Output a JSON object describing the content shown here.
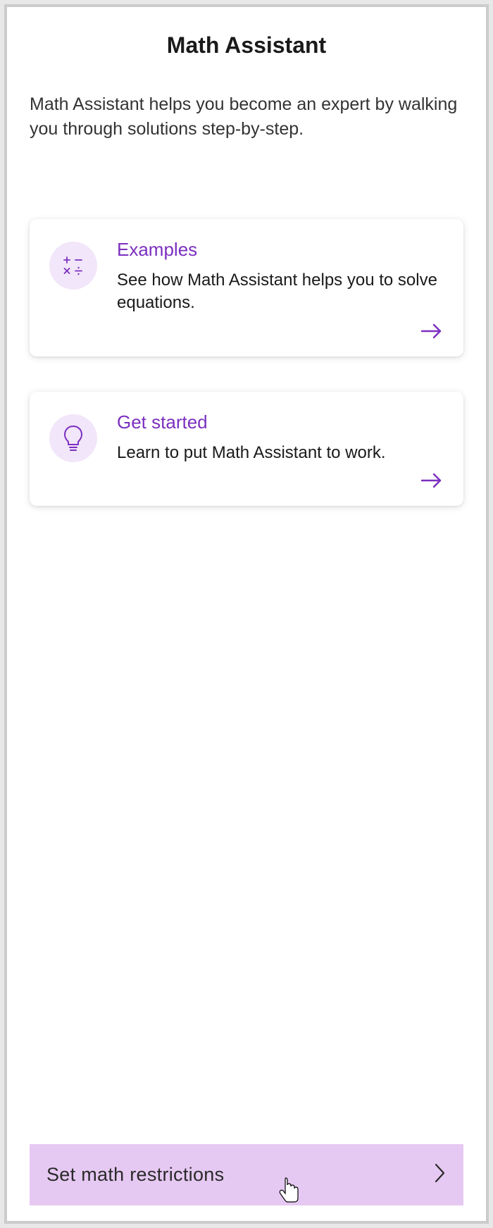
{
  "header": {
    "title": "Math Assistant"
  },
  "intro": {
    "text": "Math Assistant helps you become an expert by walking you through solutions step-by-step."
  },
  "cards": {
    "examples": {
      "title": "Examples",
      "desc": "See how Math Assistant helps you to solve equations."
    },
    "getstarted": {
      "title": "Get started",
      "desc": "Learn to put Math Assistant to work."
    }
  },
  "footer": {
    "label": "Set math restrictions"
  },
  "colors": {
    "accent": "#7b2fbf",
    "iconBg": "#f2e6fa",
    "footerBg": "#e6c9f2"
  }
}
